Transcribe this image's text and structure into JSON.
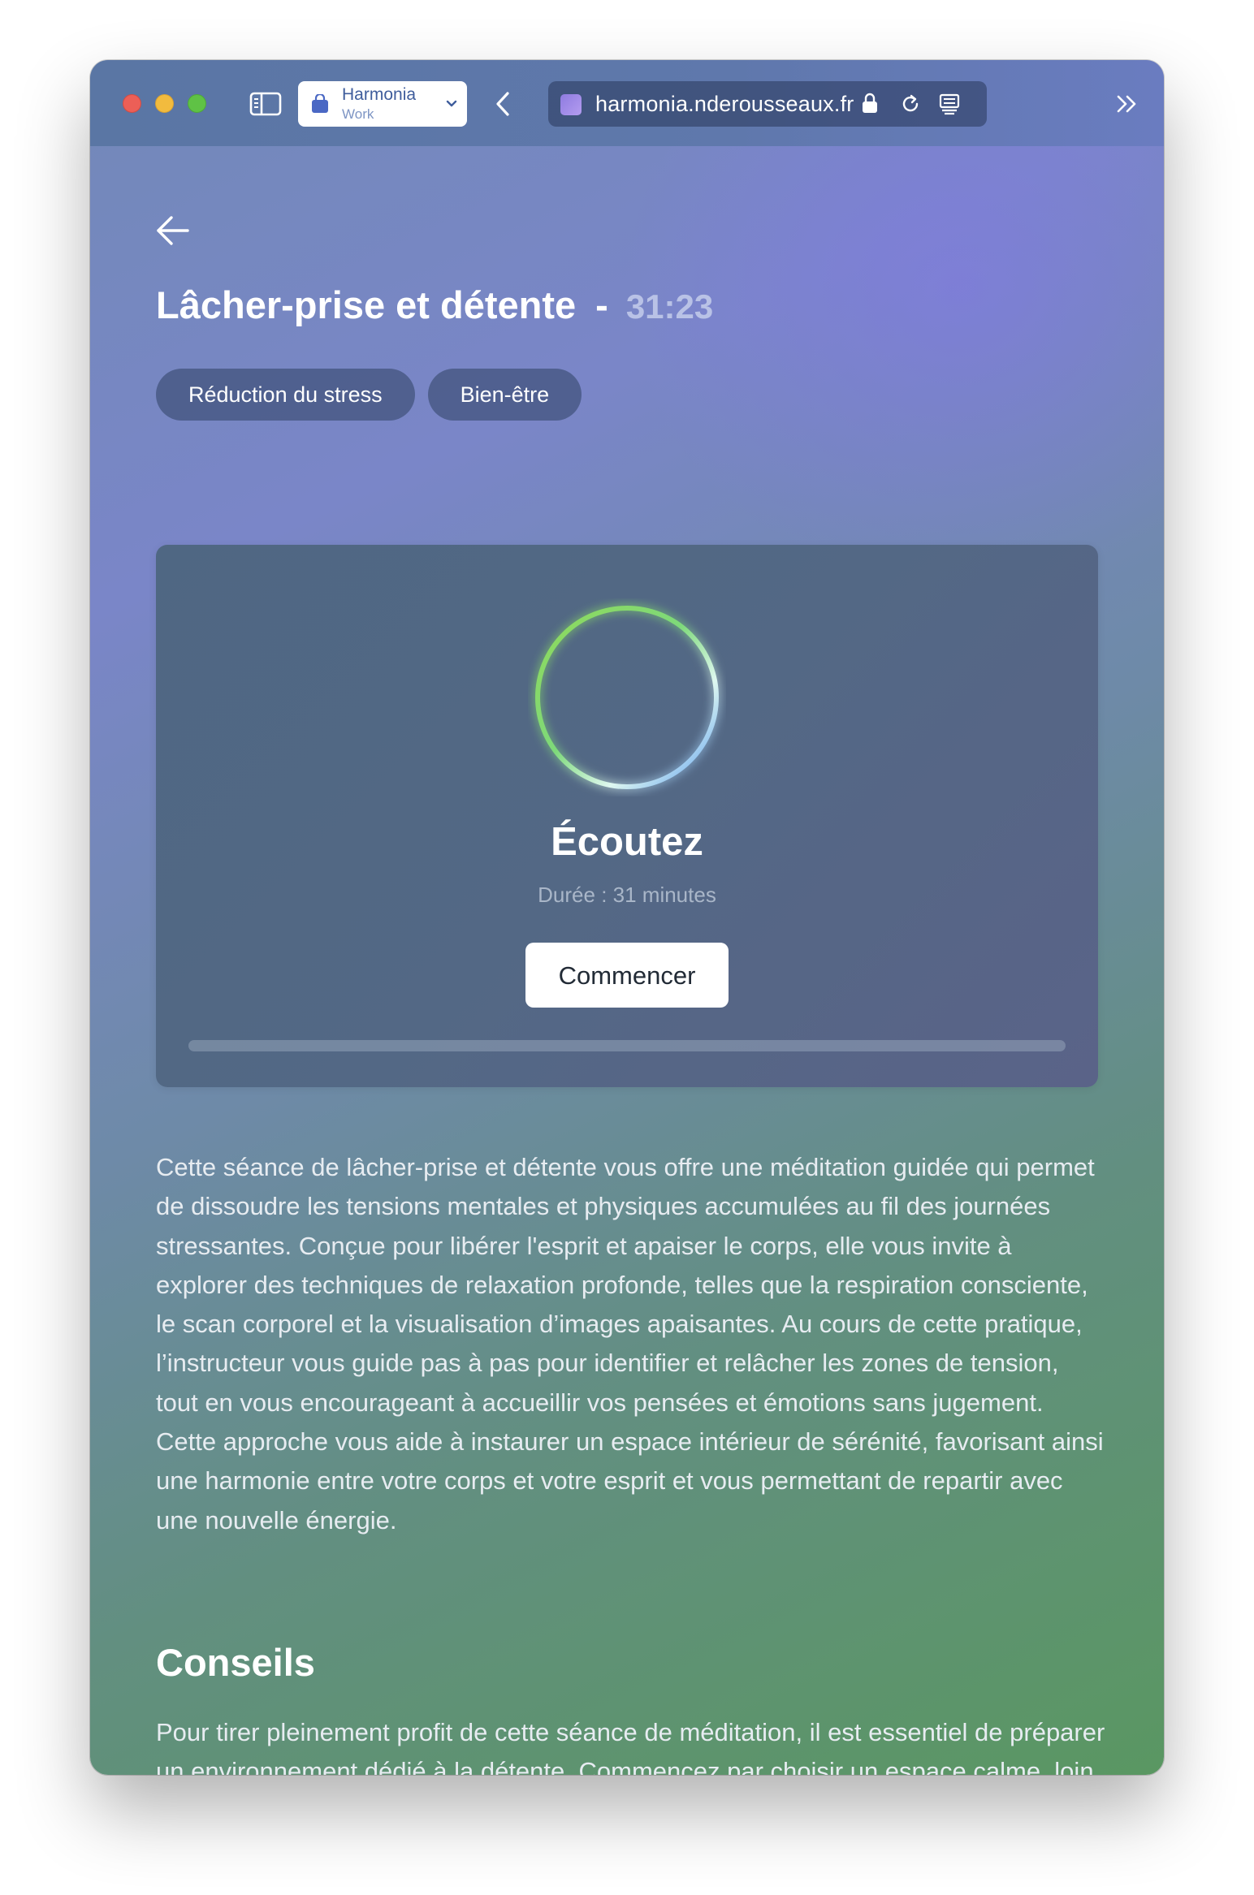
{
  "browser": {
    "profile": {
      "name": "Harmonia",
      "subtitle": "Work"
    },
    "url": "harmonia.nderousseaux.fr",
    "icons": [
      "sidebar-toggle-icon",
      "bag-icon",
      "chevron-down-icon",
      "back-chevron-icon",
      "lock-icon",
      "reload-icon",
      "reader-icon",
      "double-chevron-icon"
    ]
  },
  "session": {
    "title": "Lâcher-prise et détente",
    "separator": "-",
    "duration": "31:23",
    "tags": [
      "Réduction du stress",
      "Bien-être"
    ]
  },
  "player": {
    "title": "Écoutez",
    "duration_label": "Durée : 31 minutes",
    "start_label": "Commencer",
    "progress": 0
  },
  "description": "Cette séance de lâcher-prise et détente vous offre une méditation guidée qui permet de dissoudre les tensions mentales et physiques accumulées au fil des journées stressantes. Conçue pour libérer l'esprit et apaiser le corps, elle vous invite à explorer des techniques de relaxation profonde, telles que la respiration consciente, le scan corporel et la visualisation d’images apaisantes. Au cours de cette pratique, l’instructeur vous guide pas à pas pour identifier et relâcher les zones de tension, tout en vous encourageant à accueillir vos pensées et émotions sans jugement. Cette approche vous aide à instaurer un espace intérieur de sérénité, favorisant ainsi une harmonie entre votre corps et votre esprit et vous permettant de repartir avec une nouvelle énergie.",
  "tips": {
    "title": "Conseils",
    "text": "Pour tirer pleinement profit de cette séance de méditation, il est essentiel de préparer un environnement dédié à la détente. Commencez par choisir un espace calme, loin du tumulte quotidien, où la lumière est douce et tamisée."
  },
  "colors": {
    "ring_start": "#7ed957",
    "ring_end": "#5b9cf0",
    "accent": "#7a86c8"
  }
}
